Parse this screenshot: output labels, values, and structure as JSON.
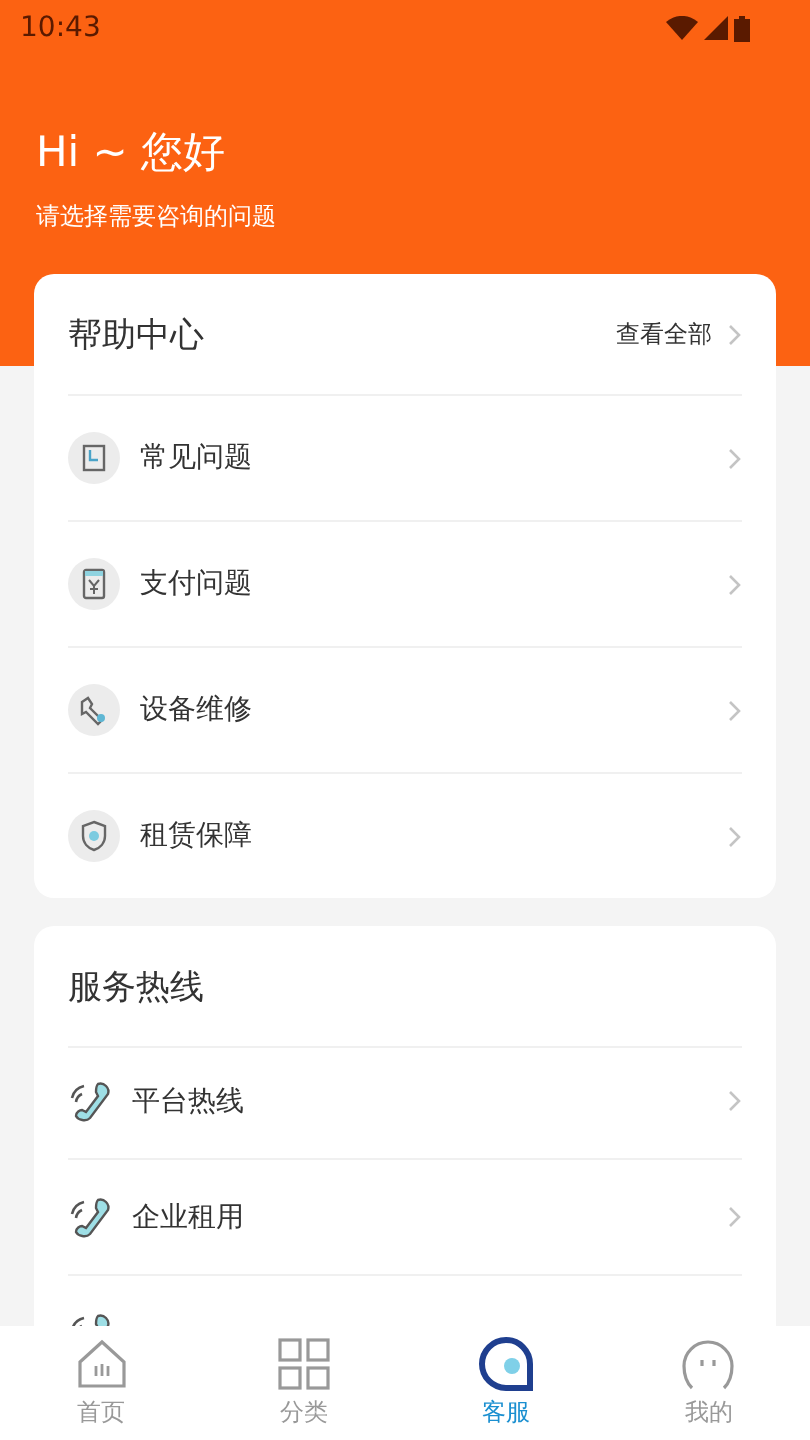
{
  "status_bar": {
    "time": "10:43"
  },
  "header": {
    "greeting": "Hi ~ 您好",
    "subtitle": "请选择需要咨询的问题"
  },
  "help_center": {
    "title": "帮助中心",
    "view_all": "查看全部",
    "items": [
      {
        "label": "常见问题",
        "kind": "book"
      },
      {
        "label": "支付问题",
        "kind": "bill"
      },
      {
        "label": "设备维修",
        "kind": "wrench"
      },
      {
        "label": "租赁保障",
        "kind": "shield"
      }
    ]
  },
  "hotlines": {
    "title": "服务热线",
    "items": [
      {
        "label": "平台热线"
      },
      {
        "label": "企业租用"
      },
      {
        "kind": "cut_off"
      }
    ]
  },
  "tab_bar": [
    {
      "label": "首页",
      "kind": "home",
      "selected": false
    },
    {
      "label": "分类",
      "kind": "grid",
      "selected": false
    },
    {
      "label": "客服",
      "kind": "chat",
      "selected": true
    },
    {
      "label": "我的",
      "kind": "face",
      "selected": false
    }
  ]
}
